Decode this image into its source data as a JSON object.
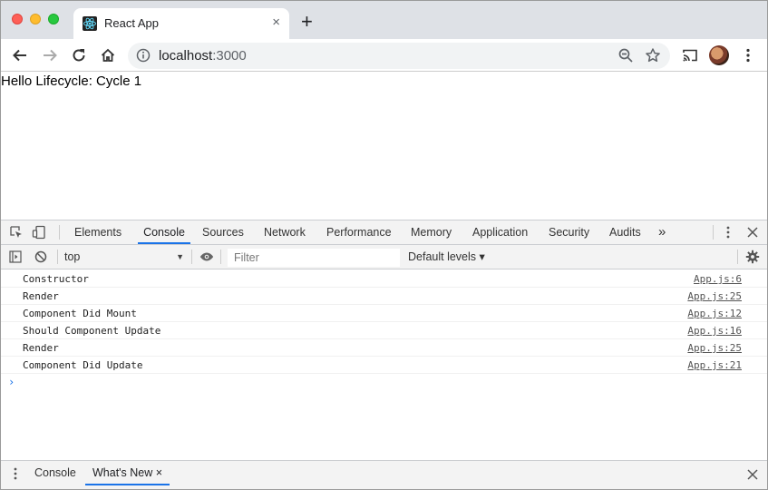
{
  "browser": {
    "tab_title": "React App",
    "tab_close": "×",
    "new_tab": "+",
    "url_host": "localhost",
    "url_port": ":3000"
  },
  "page": {
    "text": "Hello Lifecycle: Cycle 1"
  },
  "devtools": {
    "tabs": [
      "Elements",
      "Console",
      "Sources",
      "Network",
      "Performance",
      "Memory",
      "Application",
      "Security",
      "Audits"
    ],
    "more_tabs": "»",
    "active_tab": "Console",
    "context": "top",
    "context_arrow": "▼",
    "filter_placeholder": "Filter",
    "levels": "Default levels ▾",
    "messages": [
      {
        "text": "Constructor",
        "src": "App.js:6"
      },
      {
        "text": "Render",
        "src": "App.js:25"
      },
      {
        "text": "Component Did Mount",
        "src": "App.js:12"
      },
      {
        "text": "Should Component Update",
        "src": "App.js:16"
      },
      {
        "text": "Render",
        "src": "App.js:25"
      },
      {
        "text": "Component Did Update",
        "src": "App.js:21"
      }
    ],
    "prompt": "›",
    "drawer": {
      "tabs": [
        "Console",
        "What's New"
      ],
      "close_glyph": "×"
    }
  },
  "colors": {
    "accent": "#1a73e8",
    "tabstrip": "#dee1e6"
  }
}
